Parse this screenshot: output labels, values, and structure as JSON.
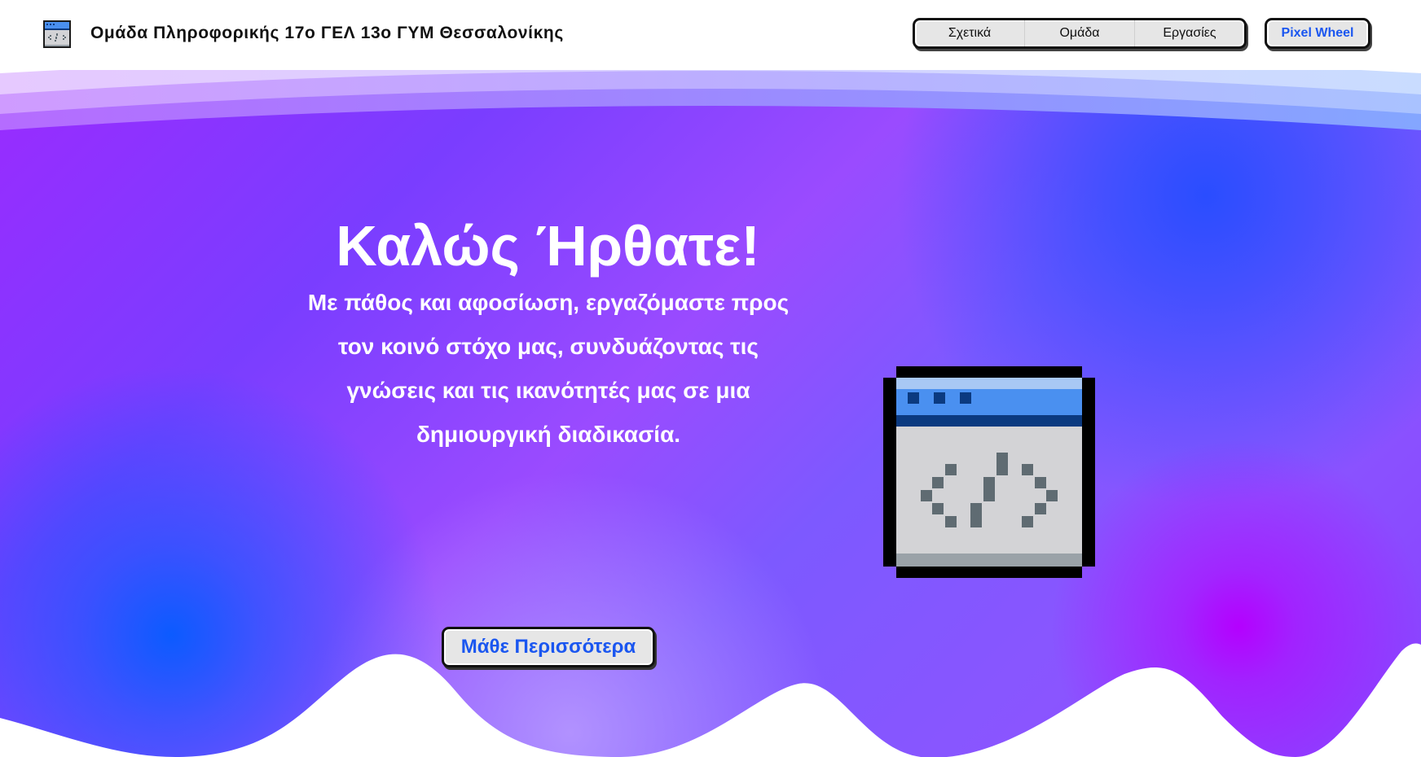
{
  "header": {
    "site_title": "Ομάδα Πληροφορικής 17ο ΓΕΛ 13ο ΓΥΜ Θεσσαλονίκης",
    "logo_icon": "code-window-icon",
    "nav_items": [
      {
        "label": "Σχετικά"
      },
      {
        "label": "Ομάδα"
      },
      {
        "label": "Εργασίες"
      }
    ],
    "special_link": {
      "label": "Pixel Wheel",
      "color": "#1a56f0"
    }
  },
  "hero": {
    "title": "Καλώς Ήρθατε!",
    "description": "Με πάθος και αφοσίωση, εργαζόμαστε προς τον κοινό στόχο μας, συνδυάζοντας τις γνώσεις και τις ικανότητές μας σε μια δημιουργική διαδικασία.",
    "cta_label": "Μάθε Περισσότερα",
    "illustration_icon": "pixel-code-window-icon"
  },
  "colors": {
    "accent": "#1a56f0",
    "hero_purple": "#9a2bff",
    "hero_blue": "#2a4dff",
    "hero_magenta": "#b400ff"
  }
}
